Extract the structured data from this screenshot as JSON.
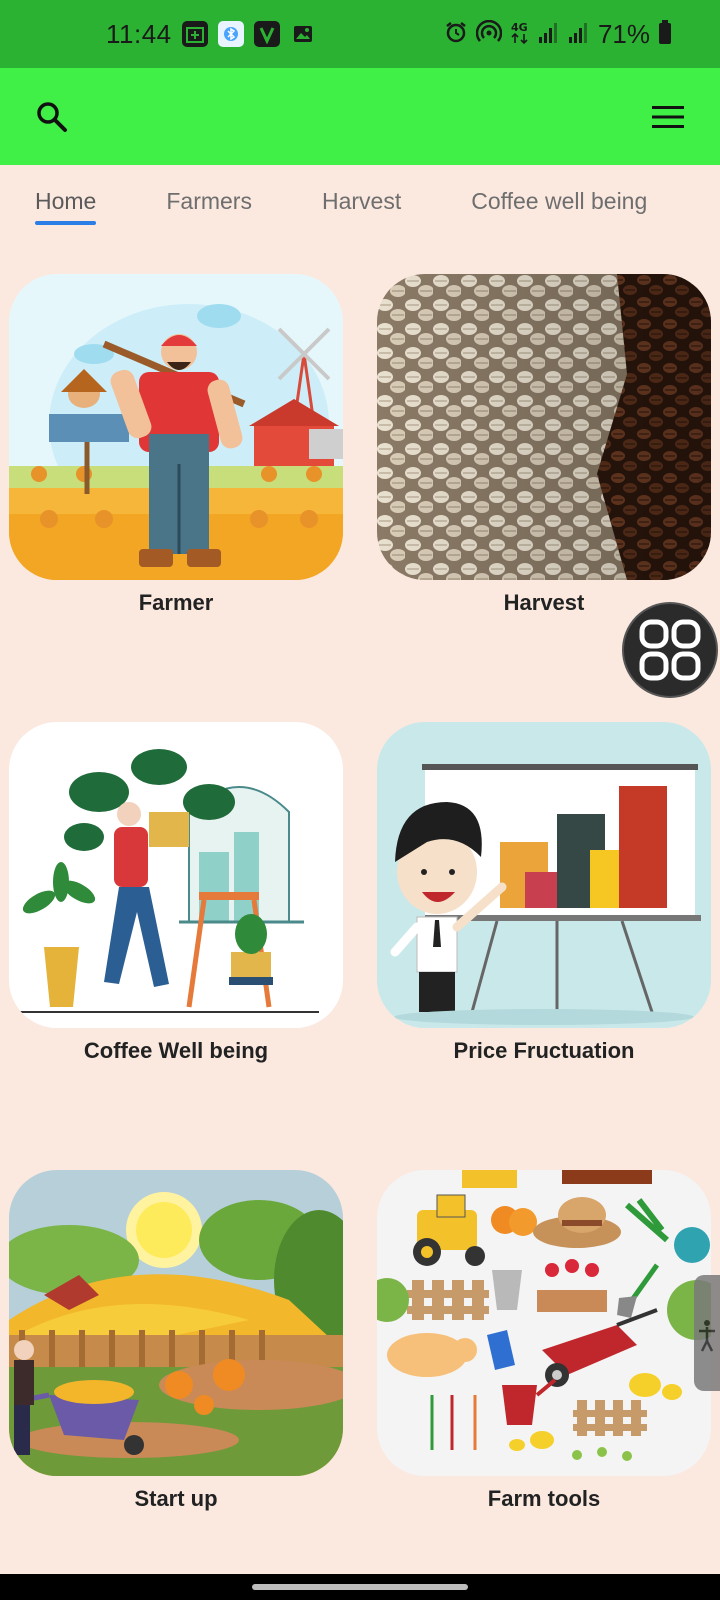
{
  "status_bar": {
    "time": "11:44",
    "battery": "71%",
    "icons": [
      "calendar-icon",
      "bluetooth-app-icon",
      "v-app-icon",
      "gallery-icon",
      "alarm-icon",
      "hotspot-icon",
      "4g-icon",
      "signal-icon",
      "signal-icon",
      "battery-icon"
    ]
  },
  "app_bar": {
    "left_icon": "search-icon",
    "right_icon": "menu-icon"
  },
  "tabs": [
    {
      "label": "Home"
    },
    {
      "label": "Farmers"
    },
    {
      "label": "Harvest"
    },
    {
      "label": "Coffee well being"
    }
  ],
  "cards": [
    {
      "label": "Farmer"
    },
    {
      "label": "Harvest"
    },
    {
      "label": "Coffee Well being"
    },
    {
      "label": "Price Fructuation"
    },
    {
      "label": "Start up"
    },
    {
      "label": "Farm tools"
    }
  ],
  "colors": {
    "status_bar": "#2bb232",
    "app_bar": "#41f046",
    "background": "#fbe9e0",
    "tab_indicator": "#2a7ee6"
  }
}
